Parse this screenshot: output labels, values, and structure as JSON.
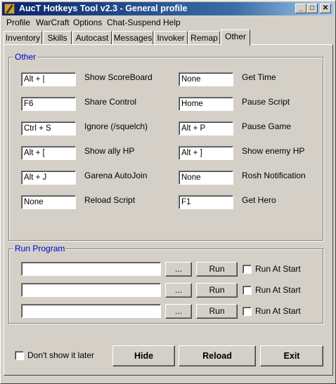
{
  "window": {
    "title": "AucT Hotkeys Tool v2.3 - General profile",
    "controls": {
      "minimize": "_",
      "maximize": "□",
      "close": "✕"
    }
  },
  "menu": [
    "Profile",
    "WarCraft",
    "Options",
    "Chat-Suspend",
    "Help"
  ],
  "tabs": [
    "Inventory",
    "Skills",
    "Autocast",
    "Messages",
    "Invoker",
    "Remap",
    "Other"
  ],
  "active_tab": "Other",
  "other_group": {
    "title": "Other",
    "left": [
      {
        "value": "Alt + |",
        "label": "Show ScoreBoard"
      },
      {
        "value": "F6",
        "label": "Share Control"
      },
      {
        "value": "Ctrl + S",
        "label": "Ignore (/squelch)"
      },
      {
        "value": "Alt + [",
        "label": "Show ally HP"
      },
      {
        "value": "Alt + J",
        "label": "Garena AutoJoin"
      },
      {
        "value": "None",
        "label": "Reload Script"
      }
    ],
    "right": [
      {
        "value": "None",
        "label": "Get Time"
      },
      {
        "value": "Home",
        "label": "Pause Script"
      },
      {
        "value": "Alt + P",
        "label": "Pause Game"
      },
      {
        "value": "Alt + ]",
        "label": "Show enemy HP"
      },
      {
        "value": "None",
        "label": "Rosh Notification"
      },
      {
        "value": "F1",
        "label": "Get Hero"
      }
    ]
  },
  "run_program": {
    "title": "Run Program",
    "rows": [
      {
        "path": "",
        "browse": "...",
        "run": "Run",
        "checkbox": "Run At Start"
      },
      {
        "path": "",
        "browse": "...",
        "run": "Run",
        "checkbox": "Run At Start"
      },
      {
        "path": "",
        "browse": "...",
        "run": "Run",
        "checkbox": "Run At Start"
      }
    ]
  },
  "footer": {
    "dont_show": "Don't show it later",
    "hide": "Hide",
    "reload": "Reload",
    "exit": "Exit"
  }
}
